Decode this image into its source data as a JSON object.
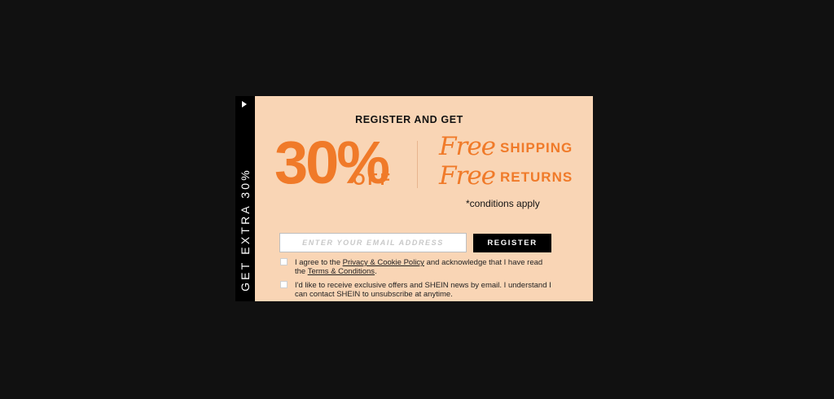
{
  "side_tab": {
    "label": "GET EXTRA 30%"
  },
  "offer": {
    "headline": "REGISTER AND GET",
    "discount": "30%",
    "discount_suffix": "OFF",
    "perk1_free": "Free",
    "perk1_text": "SHIPPING",
    "perk2_free": "Free",
    "perk2_text": "RETURNS",
    "conditions": "*conditions apply"
  },
  "form": {
    "email_placeholder": "ENTER YOUR EMAIL ADDRESS",
    "email_value": "",
    "register_label": "REGISTER",
    "consent1_pre": "I agree to the ",
    "consent1_link1": "Privacy & Cookie Policy",
    "consent1_mid": " and acknowledge that I have read the ",
    "consent1_link2": "Terms & Conditions",
    "consent1_post": ".",
    "consent2_text": "I'd like to receive exclusive offers and SHEIN news by email. I understand I can contact SHEIN to unsubscribe at anytime."
  },
  "colors": {
    "overlay": "#111111",
    "panel_bg": "#f9d5b5",
    "accent": "#f07a29",
    "tab_bg": "#000000"
  },
  "icons": {
    "expand": "play-triangle-icon"
  }
}
